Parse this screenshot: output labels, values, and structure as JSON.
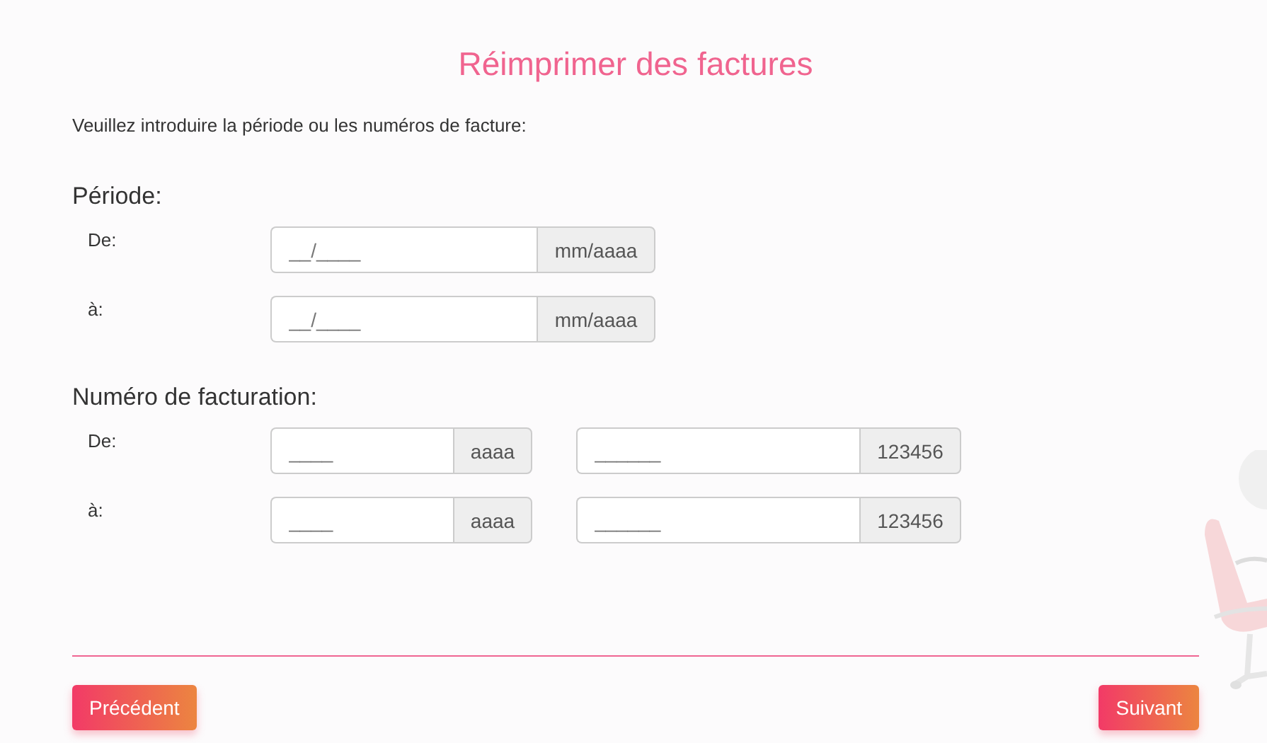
{
  "title": "Réimprimer des factures",
  "intro": "Veuillez introduire la période ou les numéros de facture:",
  "sections": [
    {
      "heading": "Période:",
      "rows": [
        {
          "label": "De:",
          "fields": [
            {
              "kind": "date",
              "placeholder": "__/____",
              "addon": "mm/aaaa"
            }
          ]
        },
        {
          "label": "à:",
          "fields": [
            {
              "kind": "date",
              "placeholder": "__/____",
              "addon": "mm/aaaa"
            }
          ]
        }
      ]
    },
    {
      "heading": "Numéro de facturation:",
      "rows": [
        {
          "label": "De:",
          "fields": [
            {
              "kind": "year",
              "placeholder": "____",
              "addon": "aaaa"
            },
            {
              "kind": "number",
              "placeholder": "______",
              "addon": "123456"
            }
          ]
        },
        {
          "label": "à:",
          "fields": [
            {
              "kind": "year",
              "placeholder": "____",
              "addon": "aaaa"
            },
            {
              "kind": "number",
              "placeholder": "______",
              "addon": "123456"
            }
          ]
        }
      ]
    }
  ],
  "buttons": [
    {
      "label": "Précédent"
    },
    {
      "label": "Suivant"
    }
  ]
}
